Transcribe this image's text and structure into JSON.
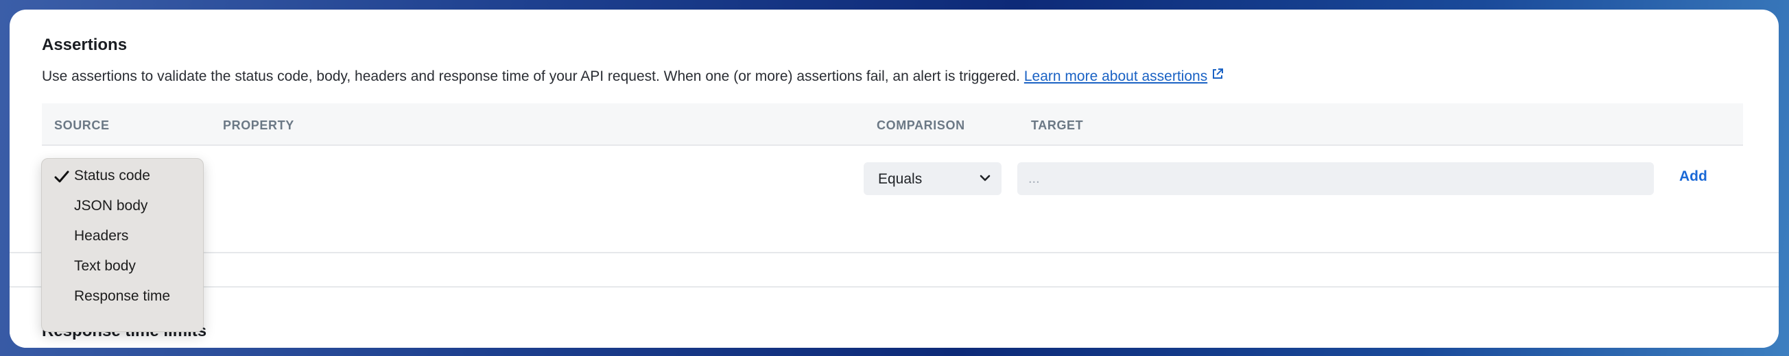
{
  "assertions": {
    "title": "Assertions",
    "description": "Use assertions to validate the status code, body, headers and response time of your API request. When one (or more) assertions fail, an alert is triggered.",
    "learn_more": "Learn more about assertions",
    "columns": [
      "SOURCE",
      "PROPERTY",
      "COMPARISON",
      "TARGET"
    ],
    "comparison_value": "Equals",
    "target_placeholder": "...",
    "add_label": "Add"
  },
  "source_dropdown": {
    "selected": "Status code",
    "options": [
      "Status code",
      "JSON body",
      "Headers",
      "Text body",
      "Response time"
    ]
  },
  "response_time_limits": {
    "title": "Response time limits"
  },
  "icons": {
    "external": "external-link-icon",
    "chevron": "chevron-down-icon",
    "check": "checkmark-icon"
  },
  "colors": {
    "link": "#1a62c4",
    "add_button": "#1a68d6",
    "header_text": "#6b7885"
  }
}
